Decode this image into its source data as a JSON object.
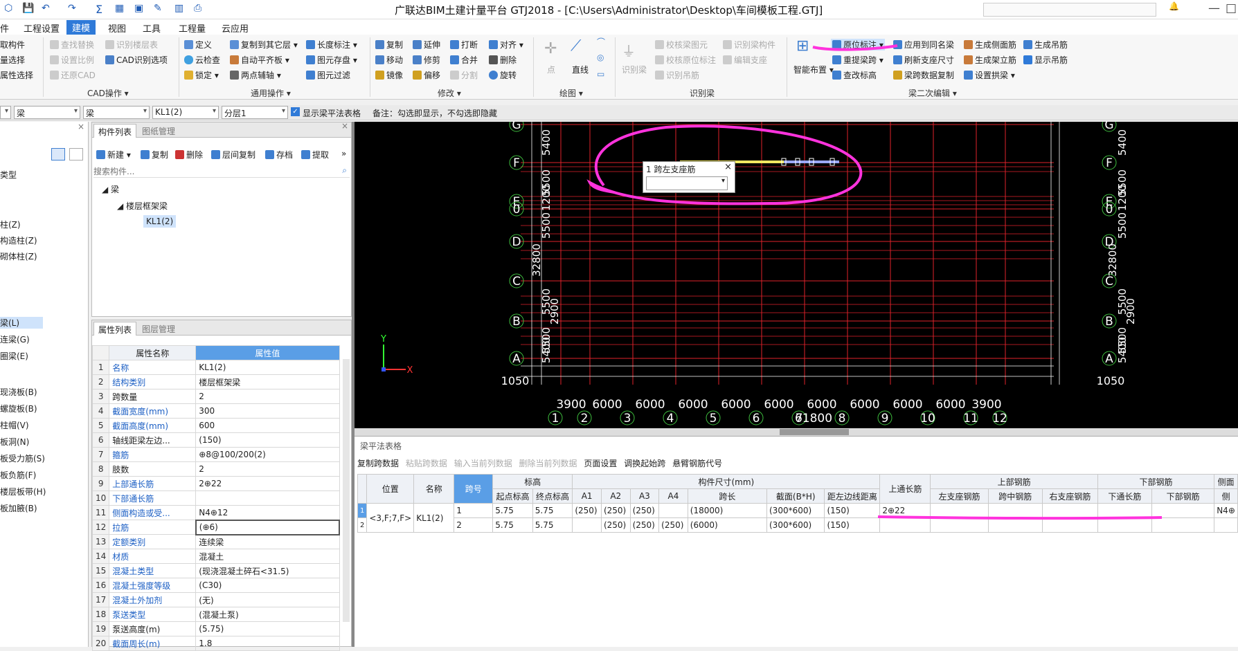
{
  "window": {
    "title": "广联达BIM土建计量平台 GTJ2018 - [C:\\Users\\Administrator\\Desktop\\车间模板工程.GTJ]"
  },
  "menu": [
    "件",
    "工程设置",
    "建模",
    "视图",
    "工具",
    "工程量",
    "云应用"
  ],
  "menu_active": "建模",
  "ribbon": {
    "left_partial": [
      "取构件",
      "量选择",
      "属性选择"
    ],
    "select_cad": [
      "查找替换",
      "设置比例",
      "还原CAD",
      "识别楼层表",
      "CAD识别选项"
    ],
    "cad_group": "CAD操作",
    "general": [
      "定义",
      "云检查",
      "锁定",
      "复制到其它层",
      "自动平齐板",
      "两点辅轴",
      "长度标注",
      "图元存盘",
      "图元过滤"
    ],
    "general_group": "通用操作",
    "modify": [
      "复制",
      "移动",
      "镜像",
      "延伸",
      "修剪",
      "偏移",
      "打断",
      "合并",
      "分割",
      "对齐",
      "删除",
      "旋转"
    ],
    "modify_group": "修改",
    "draw": [
      "点",
      "直线"
    ],
    "draw_group": "绘图",
    "recognize": [
      "识别梁",
      "校核梁图元",
      "校核原位标注",
      "识别吊筋",
      "识别梁构件",
      "编辑支座"
    ],
    "recognize_group": "识别梁",
    "beam2": [
      "智能布置",
      "原位标注",
      "重提梁跨",
      "查改标高",
      "应用到同名梁",
      "刷新支座尺寸",
      "梁跨数据复制",
      "生成侧面筋",
      "生成架立筋",
      "设置拱梁",
      "生成吊筋",
      "显示吊筋"
    ],
    "beam2_group": "梁二次编辑"
  },
  "toolbar2": {
    "c1": "梁",
    "c2": "梁",
    "c3": "KL1(2)",
    "c4": "分层1",
    "check": "显示梁平法表格",
    "note": "备注：勾选即显示，不勾选即隐藏"
  },
  "leftnav": [
    "类型",
    "柱(Z)",
    "构造柱(Z)",
    "砌体柱(Z)",
    "梁(L)",
    "连梁(G)",
    "圈梁(E)",
    "现浇板(B)",
    "螺旋板(B)",
    "柱帽(V)",
    "板洞(N)",
    "板受力筋(S)",
    "板负筋(F)",
    "楼层板带(H)",
    "板加腋(B)"
  ],
  "comp": {
    "tabs": [
      "构件列表",
      "图纸管理"
    ],
    "tools": [
      "新建",
      "复制",
      "删除",
      "层间复制",
      "存档",
      "提取"
    ],
    "search_placeholder": "搜索构件...",
    "tree": [
      "梁",
      "楼层框架梁",
      "KL1(2)"
    ]
  },
  "props": {
    "tabs": [
      "属性列表",
      "图层管理"
    ],
    "h1": "属性名称",
    "h2": "属性值",
    "rows": [
      [
        "1",
        "名称",
        "KL1(2)"
      ],
      [
        "2",
        "结构类别",
        "楼层框架梁"
      ],
      [
        "3",
        "跨数量",
        "2"
      ],
      [
        "4",
        "截面宽度(mm)",
        "300"
      ],
      [
        "5",
        "截面高度(mm)",
        "600"
      ],
      [
        "6",
        "轴线距梁左边...",
        "(150)"
      ],
      [
        "7",
        "箍筋",
        "⊕8@100/200(2)"
      ],
      [
        "8",
        "肢数",
        "2"
      ],
      [
        "9",
        "上部通长筋",
        "2⊕22"
      ],
      [
        "10",
        "下部通长筋",
        ""
      ],
      [
        "11",
        "侧面构造或受...",
        "N4⊕12"
      ],
      [
        "12",
        "拉筋",
        "(⊕6)"
      ],
      [
        "13",
        "定额类别",
        "连续梁"
      ],
      [
        "14",
        "材质",
        "混凝土"
      ],
      [
        "15",
        "混凝土类型",
        "(现浇混凝土碎石<31.5)"
      ],
      [
        "16",
        "混凝土强度等级",
        "(C30)"
      ],
      [
        "17",
        "混凝土外加剂",
        "(无)"
      ],
      [
        "18",
        "泵送类型",
        "(混凝土泵)"
      ],
      [
        "19",
        "泵送高度(m)",
        "(5.75)"
      ],
      [
        "20",
        "截面周长(m)",
        "1.8"
      ]
    ]
  },
  "canvas": {
    "axis_letters": [
      "G",
      "F",
      "E",
      "0",
      "D",
      "C",
      "B",
      "A"
    ],
    "left_dims": [
      "5400",
      "5500",
      "1200",
      "5500",
      "32800",
      "5500",
      "5500",
      "5400",
      "2900",
      "1050"
    ],
    "bottom_nums": [
      "1",
      "2",
      "3",
      "4",
      "5",
      "6",
      "7",
      "8",
      "9",
      "10",
      "11",
      "12"
    ],
    "bottom_dims": [
      "3900",
      "6000",
      "6000",
      "6000",
      "6000",
      "6000",
      "6000",
      "6000",
      "6000",
      "6000",
      "3900"
    ],
    "total": "61800",
    "popup_title": "1 跨左支座筋",
    "popup_value": "",
    "x_label": "X",
    "y_label": "Y",
    "colors": {
      "grid": "#e0222a",
      "axis": "#3fbf3f",
      "beam": "#f0e860",
      "mark": "#ff33dd"
    }
  },
  "bottom": {
    "title": "梁平法表格",
    "tools": [
      "复制跨数据",
      "粘贴跨数据",
      "输入当前列数据",
      "删除当前列数据",
      "页面设置",
      "调换起始跨",
      "悬臂钢筋代号"
    ],
    "h_top": [
      "位置",
      "名称",
      "跨号",
      "标高",
      "构件尺寸(mm)",
      "上通长筋",
      "上部钢筋",
      "下部钢筋",
      "侧面"
    ],
    "h_sub": [
      "起点标高",
      "终点标高",
      "A1",
      "A2",
      "A3",
      "A4",
      "跨长",
      "截面(B*H)",
      "距左边线距离",
      "左支座钢筋",
      "跨中钢筋",
      "右支座钢筋",
      "下通长筋",
      "下部钢筋",
      "侧"
    ],
    "rows": [
      [
        "1",
        "<3,F;7,F>",
        "KL1(2)",
        "1",
        "5.75",
        "5.75",
        "(250)",
        "(250)",
        "(250)",
        "",
        "(18000)",
        "(300*600)",
        "(150)",
        "2⊕22",
        "N4⊕"
      ],
      [
        "2",
        "",
        "",
        "2",
        "5.75",
        "5.75",
        "",
        "(250)",
        "(250)",
        "(250)",
        "(6000)",
        "(300*600)",
        "(150)",
        "",
        ""
      ]
    ]
  }
}
